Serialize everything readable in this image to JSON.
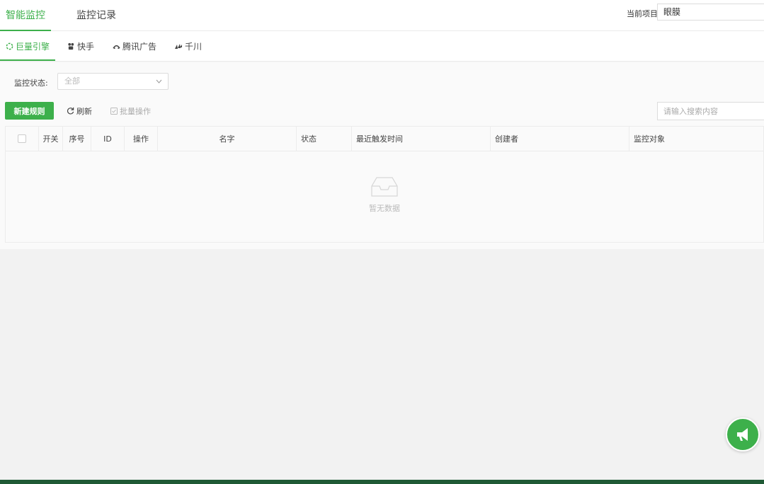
{
  "top_tabs": [
    {
      "label": "智能监控",
      "active": true
    },
    {
      "label": "监控记录",
      "active": false
    }
  ],
  "project": {
    "label": "当前项目",
    "value": "眼膜"
  },
  "platform_tabs": [
    {
      "label": "巨量引擎",
      "icon": "ocean-engine-icon",
      "active": true
    },
    {
      "label": "快手",
      "icon": "kuaishou-icon",
      "active": false
    },
    {
      "label": "腾讯广告",
      "icon": "tencent-ads-icon",
      "active": false
    },
    {
      "label": "千川",
      "icon": "qianchuan-icon",
      "active": false
    }
  ],
  "filter": {
    "label": "监控状态:",
    "placeholder": "全部"
  },
  "toolbar": {
    "new_rule": "新建规则",
    "refresh": "刷新",
    "batch": "批量操作",
    "search_placeholder": "请输入搜索内容"
  },
  "table": {
    "columns": [
      "开关",
      "序号",
      "ID",
      "操作",
      "名字",
      "状态",
      "最近触发时间",
      "创建者",
      "监控对象"
    ],
    "rows": [],
    "empty_text": "暂无数据"
  },
  "colors": {
    "accent": "#3db04b",
    "footer": "#1f5a35"
  }
}
